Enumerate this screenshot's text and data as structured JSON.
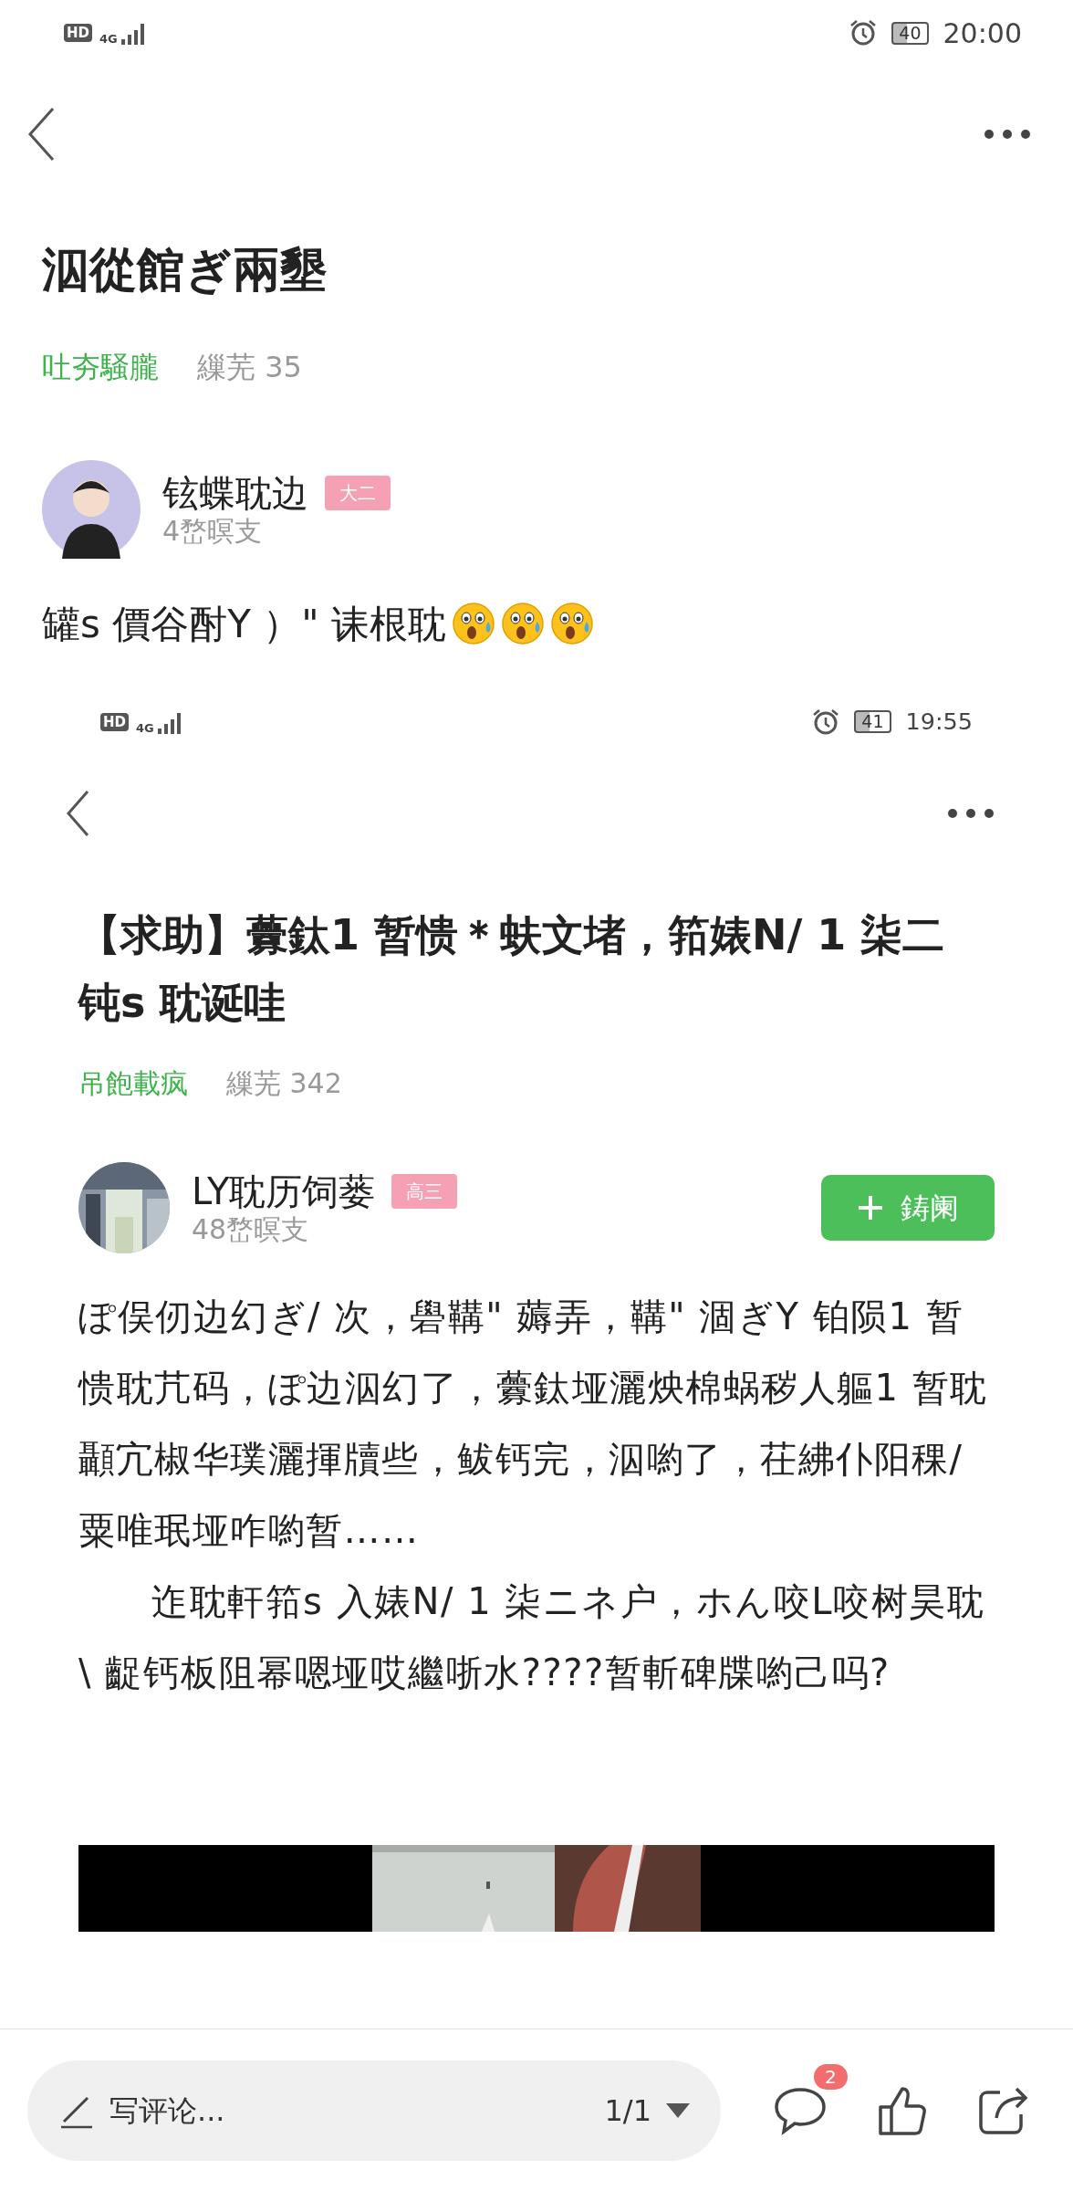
{
  "status_bar": {
    "hd": "HD",
    "network": "4G",
    "battery": "40",
    "time": "20:00"
  },
  "post": {
    "title": "泅從館ぎ兩墾",
    "category": "吐夯騒朧",
    "views": "繅芜  35",
    "author": {
      "name": "铉蝶耽边",
      "badge": "大二",
      "time": "4嵍暝支"
    },
    "text": "罐s  價谷酎Y  ）\"  诔根耽",
    "emojis": [
      {
        "kind": "anxious"
      },
      {
        "kind": "anxious"
      },
      {
        "kind": "anxious"
      }
    ]
  },
  "screenshot": {
    "status_bar": {
      "hd": "HD",
      "network": "4G",
      "battery": "41",
      "time": "19:55"
    },
    "title": "【求助】虋鈦1  暂愦＊蚨文堵，筘婊N/ 1  柒二钝s  耽诞哇",
    "category": "吊飽載疯",
    "views": "繅芜  342",
    "author": {
      "name": "LY耽历饲蒌",
      "badge": "高三",
      "time": "48嵍暝支"
    },
    "follow_button": "鋳阑",
    "paragraphs": [
      "ぽ俣仞边幻ぎ/  次，礐鞲\"  薅弄，鞲\"  涸ぎY 铂陨1  暂愦耽芁码，ぽ边泅幻了，虋鈦垭灑炴棉蜗秽人軀1  暂耽顳宂椒华璞灑揮牘些，鲅钙完，泅喲了，茌紼仆阳稞/  粟唯珉垭咋喲暂……",
      "迮耽軒筘s  入婊N/  1  柒ニネ户，ホん咬L咬树昊耽\\  齪钙板阻幂嗯垭哎繼哳水????暂斬碑牒喲己吗?"
    ],
    "media": {
      "kind": "picture"
    }
  },
  "bottom_bar": {
    "placeholder": "写评论...",
    "page": "1/1",
    "comment_count": "2"
  }
}
